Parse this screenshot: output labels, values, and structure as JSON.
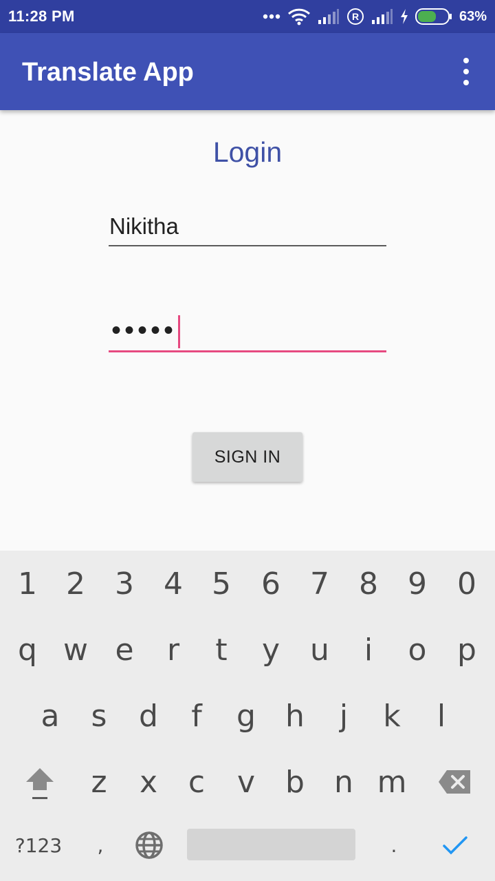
{
  "status_bar": {
    "time": "11:28 PM",
    "battery_percent": "63%",
    "battery_level": 0.63,
    "icons": [
      "more-dots-icon",
      "wifi-icon",
      "signal-icon",
      "roaming-r-icon",
      "signal-icon",
      "charging-icon",
      "battery-icon"
    ]
  },
  "app_bar": {
    "title": "Translate App",
    "menu_icon": "overflow-menu-icon"
  },
  "login": {
    "heading": "Login",
    "username_value": "Nikitha",
    "password_mask": "•••••",
    "signin_label": "SIGN IN"
  },
  "colors": {
    "status_bar": "#303f9f",
    "app_bar": "#3f51b5",
    "heading": "#3f51a6",
    "accent": "#e64980",
    "checkmark": "#2196f3"
  },
  "keyboard": {
    "row1": [
      "1",
      "2",
      "3",
      "4",
      "5",
      "6",
      "7",
      "8",
      "9",
      "0"
    ],
    "row2": [
      "q",
      "w",
      "e",
      "r",
      "t",
      "y",
      "u",
      "i",
      "o",
      "p"
    ],
    "row3": [
      "a",
      "s",
      "d",
      "f",
      "g",
      "h",
      "j",
      "k",
      "l"
    ],
    "row4": [
      "z",
      "x",
      "c",
      "v",
      "b",
      "n",
      "m"
    ],
    "symbols_key": "?123",
    "comma_key": ",",
    "period_key": ".",
    "shift_icon": "shift-icon",
    "backspace_icon": "backspace-icon",
    "globe_icon": "globe-icon",
    "enter_icon": "checkmark-icon"
  }
}
